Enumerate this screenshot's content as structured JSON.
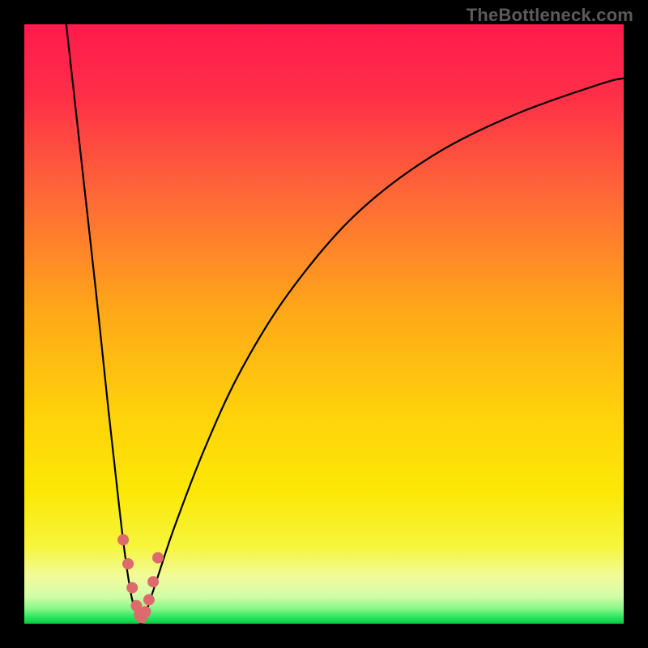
{
  "watermark": "TheBottleneck.com",
  "background": {
    "stops": [
      {
        "offset": 0.0,
        "color": "#ff1a4d"
      },
      {
        "offset": 0.12,
        "color": "#ff2f48"
      },
      {
        "offset": 0.28,
        "color": "#ff6638"
      },
      {
        "offset": 0.48,
        "color": "#ffa818"
      },
      {
        "offset": 0.65,
        "color": "#ffd20a"
      },
      {
        "offset": 0.78,
        "color": "#fbe806"
      },
      {
        "offset": 0.87,
        "color": "#f6f53a"
      },
      {
        "offset": 0.92,
        "color": "#f2fb9a"
      },
      {
        "offset": 0.955,
        "color": "#d2fda8"
      },
      {
        "offset": 0.975,
        "color": "#86f789"
      },
      {
        "offset": 0.99,
        "color": "#28e45e"
      },
      {
        "offset": 1.0,
        "color": "#07c93e"
      }
    ]
  },
  "curve": {
    "stroke": "#000000",
    "stroke_width": 2.2
  },
  "markers": {
    "fill": "#dd6a6c",
    "radius": 7
  },
  "chart_data": {
    "type": "line",
    "title": "",
    "xlabel": "",
    "ylabel": "",
    "xlim": [
      0,
      100
    ],
    "ylim": [
      0,
      100
    ],
    "grid": false,
    "legend": "none",
    "annotations": [
      "TheBottleneck.com"
    ],
    "series": [
      {
        "name": "bottleneck-curve",
        "x": [
          7,
          8,
          10,
          12,
          14,
          15,
          16,
          17,
          18,
          19,
          19.5,
          20,
          22,
          25,
          30,
          36,
          44,
          55,
          68,
          82,
          96,
          100
        ],
        "y": [
          100,
          91,
          73,
          55,
          36,
          27,
          18,
          10,
          4,
          1,
          0,
          1,
          7,
          16,
          29,
          42,
          55,
          68,
          78,
          85,
          90,
          91
        ]
      }
    ],
    "scatter_points": {
      "name": "highlight-cluster",
      "x": [
        16.5,
        17.3,
        18.0,
        18.7,
        19.2,
        19.6,
        20.2,
        20.8,
        21.5,
        22.3
      ],
      "y": [
        14,
        10,
        6,
        3,
        1.5,
        1,
        2,
        4,
        7,
        11
      ]
    },
    "minimum": {
      "x": 19.5,
      "y": 0
    }
  }
}
